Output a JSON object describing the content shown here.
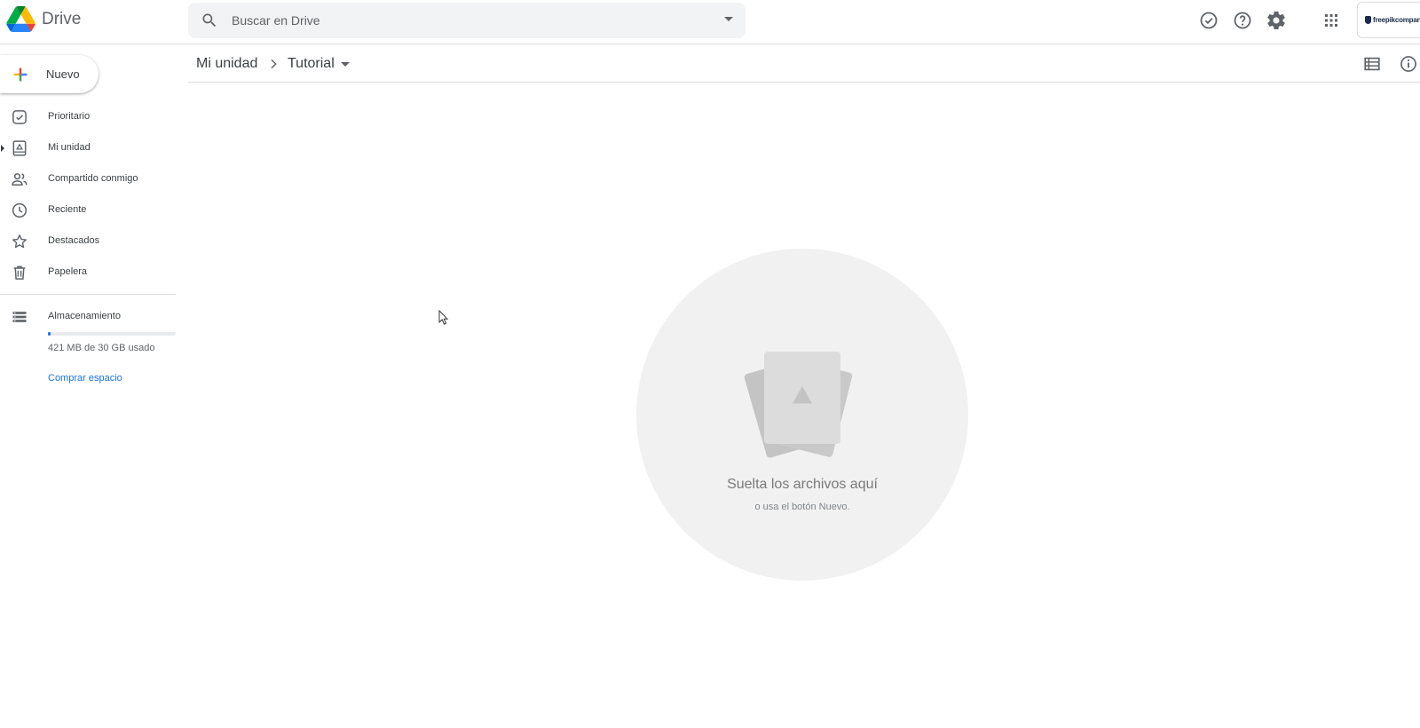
{
  "app": {
    "name": "Drive"
  },
  "search": {
    "placeholder": "Buscar en Drive"
  },
  "header": {
    "icons": [
      "offline-ready-icon",
      "help-icon",
      "settings-icon",
      "apps-grid-icon"
    ],
    "account_label": "freepikcompany"
  },
  "sidebar": {
    "new_label": "Nuevo",
    "items": [
      {
        "label": "Prioritario",
        "icon": "priority-icon"
      },
      {
        "label": "Mi unidad",
        "icon": "my-drive-icon"
      },
      {
        "label": "Compartido conmigo",
        "icon": "shared-icon"
      },
      {
        "label": "Reciente",
        "icon": "clock-icon"
      },
      {
        "label": "Destacados",
        "icon": "star-icon"
      },
      {
        "label": "Papelera",
        "icon": "trash-icon"
      }
    ],
    "storage": {
      "label": "Almacenamiento",
      "usage": "421 MB de 30 GB usado",
      "used_fraction": 0.014,
      "buy_label": "Comprar espacio"
    }
  },
  "breadcrumb": {
    "root": "Mi unidad",
    "current": "Tutorial"
  },
  "empty_state": {
    "title": "Suelta los archivos aquí",
    "subtitle": "o usa el botón Nuevo."
  },
  "colors": {
    "accent": "#1a73e8",
    "divider": "#dadce0",
    "search_bg": "#f1f3f4"
  }
}
